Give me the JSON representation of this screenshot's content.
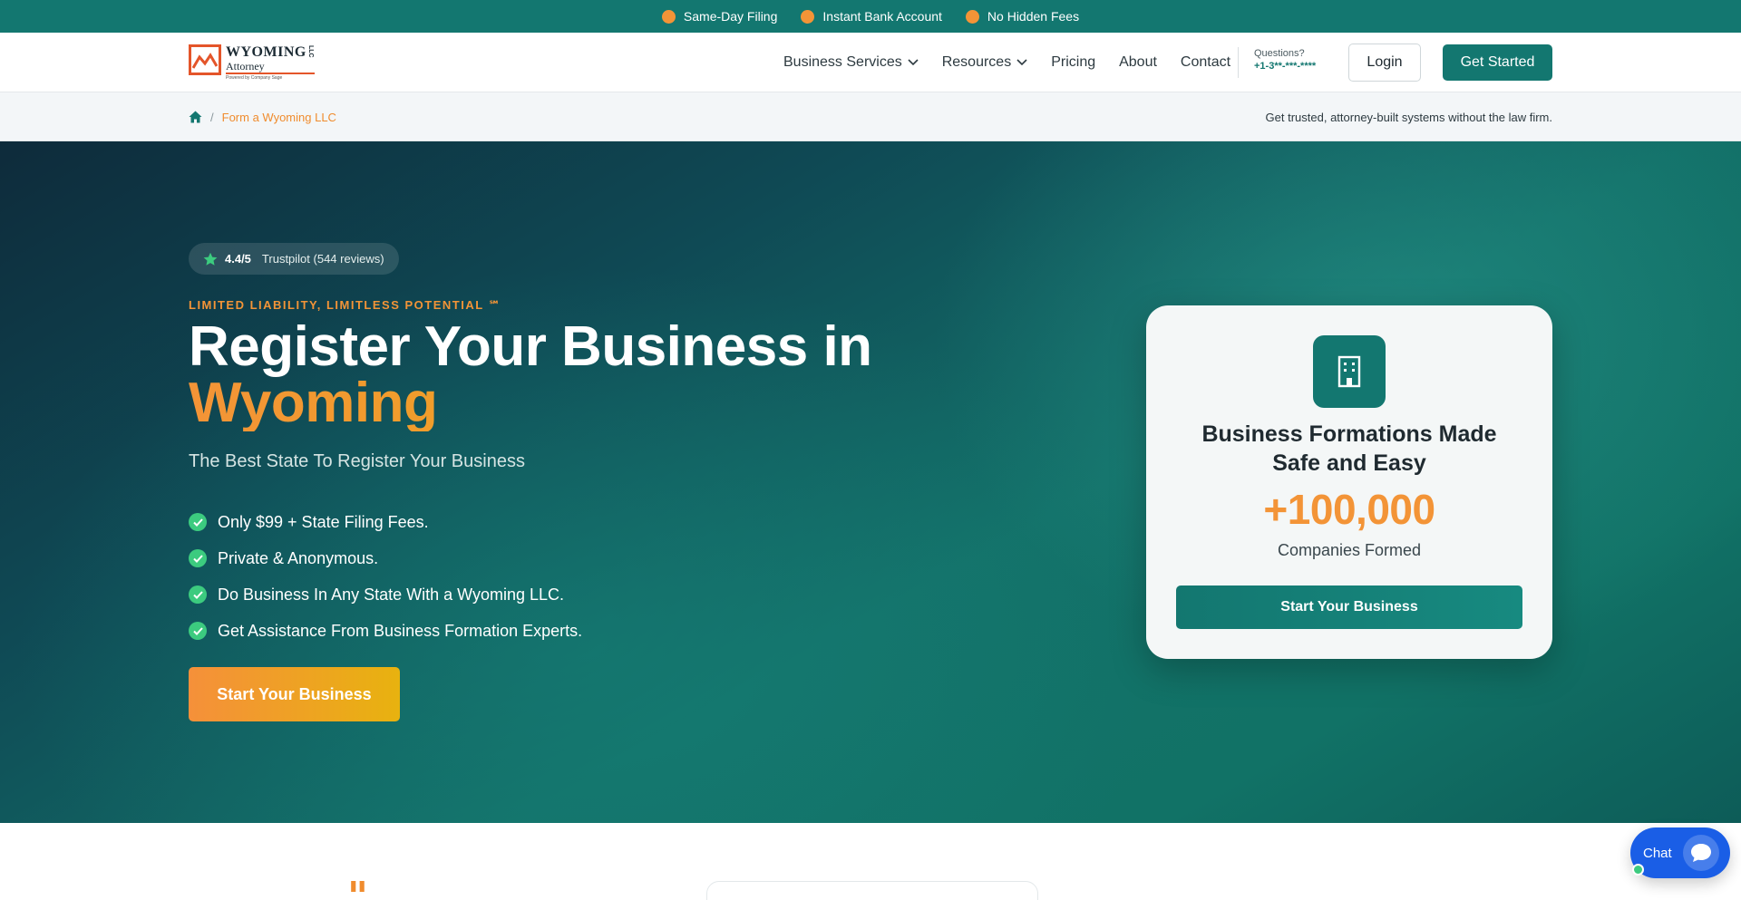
{
  "topbar": {
    "perks": [
      "Same-Day Filing",
      "Instant Bank Account",
      "No Hidden Fees"
    ]
  },
  "header": {
    "logo": {
      "title": "WYOMING",
      "llc": "LLC",
      "subtitle": "Attorney",
      "tagline": "Powered by Company Sage"
    },
    "nav": [
      {
        "label": "Business Services",
        "has_dropdown": true
      },
      {
        "label": "Resources",
        "has_dropdown": true
      },
      {
        "label": "Pricing",
        "has_dropdown": false
      },
      {
        "label": "About",
        "has_dropdown": false
      },
      {
        "label": "Contact",
        "has_dropdown": false
      }
    ],
    "questions_label": "Questions?",
    "phone": "+1-3**-***-****",
    "login_label": "Login",
    "get_started_label": "Get Started"
  },
  "breadcrumb": {
    "separator": "/",
    "current": "Form a Wyoming LLC",
    "tagline": "Get trusted, attorney-built systems without the law firm."
  },
  "hero": {
    "rating": {
      "score": "4.4/5",
      "source": "Trustpilot (544 reviews)"
    },
    "eyebrow": "LIMITED LIABILITY, LIMITLESS POTENTIAL ℠",
    "headline_line1": "Register Your Business in",
    "headline_accent": "Wyoming",
    "subhead": "The Best State To Register Your Business",
    "bullets": [
      "Only $99 + State Filing Fees.",
      "Private & Anonymous.",
      "Do Business In Any State With a Wyoming LLC.",
      "Get Assistance From Business Formation Experts."
    ],
    "cta_label": "Start Your Business"
  },
  "card": {
    "title": "Business Formations Made Safe and Easy",
    "stat": "+100,000",
    "stat_label": "Companies Formed",
    "button_label": "Start Your Business"
  },
  "lower": {
    "quote_mark": "\""
  },
  "chat": {
    "label": "Chat"
  },
  "colors": {
    "primary": "#137770",
    "accent_orange": "#f39437",
    "accent_gold": "#e8b20f",
    "check_green": "#3ccb7f",
    "chat_blue": "#1a5ee6"
  }
}
